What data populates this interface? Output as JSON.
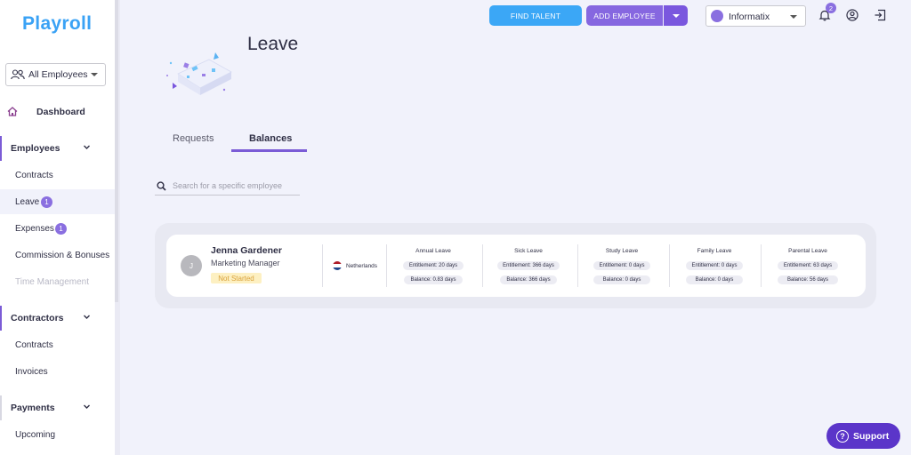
{
  "app": {
    "logo": "Playroll"
  },
  "sidebar": {
    "employee_filter": "All Employees",
    "dashboard": "Dashboard",
    "groups": [
      {
        "label": "Employees",
        "items": [
          {
            "label": "Contracts"
          },
          {
            "label": "Leave",
            "badge": "1"
          },
          {
            "label": "Expenses",
            "badge": "1"
          },
          {
            "label": "Commission & Bonuses"
          },
          {
            "label": "Time Management"
          }
        ]
      },
      {
        "label": "Contractors",
        "items": [
          {
            "label": "Contracts"
          },
          {
            "label": "Invoices"
          }
        ]
      },
      {
        "label": "Payments",
        "items": [
          {
            "label": "Upcoming"
          }
        ]
      }
    ]
  },
  "topbar": {
    "find_talent": "FIND TALENT",
    "add_employee": "ADD EMPLOYEE",
    "company": "Informatix",
    "notification_count": "2"
  },
  "page": {
    "title": "Leave",
    "tabs": [
      {
        "label": "Requests",
        "active": false
      },
      {
        "label": "Balances",
        "active": true
      }
    ],
    "search_placeholder": "Search for a specific employee"
  },
  "employee": {
    "initial": "J",
    "name": "Jenna Gardener",
    "role": "Marketing Manager",
    "status": "Not Started",
    "country": "Netherlands",
    "leave": [
      {
        "type": "Annual Leave",
        "entitlement": "Entitlement: 20 days",
        "balance": "Balance: 0.83 days"
      },
      {
        "type": "Sick Leave",
        "entitlement": "Entitlement: 366 days",
        "balance": "Balance: 366 days"
      },
      {
        "type": "Study Leave",
        "entitlement": "Entitlement: 0 days",
        "balance": "Balance: 0 days"
      },
      {
        "type": "Family Leave",
        "entitlement": "Entitlement: 0 days",
        "balance": "Balance: 0 days"
      },
      {
        "type": "Parental Leave",
        "entitlement": "Entitlement: 63 days",
        "balance": "Balance: 56 days"
      }
    ]
  },
  "support": {
    "label": "Support"
  },
  "colors": {
    "brand_blue": "#3ba7f6",
    "brand_purple": "#8667e0",
    "support_purple": "#5b35c9",
    "status_bg": "#fdf0c2",
    "status_text": "#d9a13a"
  }
}
